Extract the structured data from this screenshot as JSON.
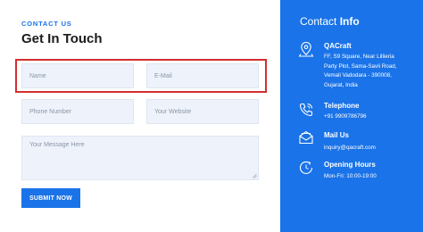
{
  "form": {
    "eyebrow": "CONTACT US",
    "heading": "Get In Touch",
    "name_placeholder": "Name",
    "email_placeholder": "E-Mail",
    "phone_placeholder": "Phone Number",
    "website_placeholder": "Your Website",
    "message_placeholder": "Your Message Here",
    "submit_label": "SUBMIT NOW"
  },
  "info": {
    "title_plain": "Contact ",
    "title_bold": "Info",
    "company": {
      "title": "QACraft",
      "lines": [
        "FF, S9 Square, Near Lillieria",
        "Party Plot, Sama-Savli Road,",
        "Vemali Vadodara - 390008,",
        "Gujarat, India"
      ]
    },
    "telephone": {
      "title": "Telephone",
      "value": "+91 9909786796"
    },
    "mail": {
      "title": "Mail Us",
      "value": "inquiry@qacraft.com"
    },
    "hours": {
      "title": "Opening Hours",
      "value": "Mon-Fri: 10:00-19:00"
    }
  },
  "colors": {
    "accent": "#1a73e8",
    "highlight": "#d32f2f",
    "field_bg": "#eef3fb"
  },
  "icons": [
    "location-icon",
    "phone-icon",
    "mail-icon",
    "clock-24-icon"
  ]
}
